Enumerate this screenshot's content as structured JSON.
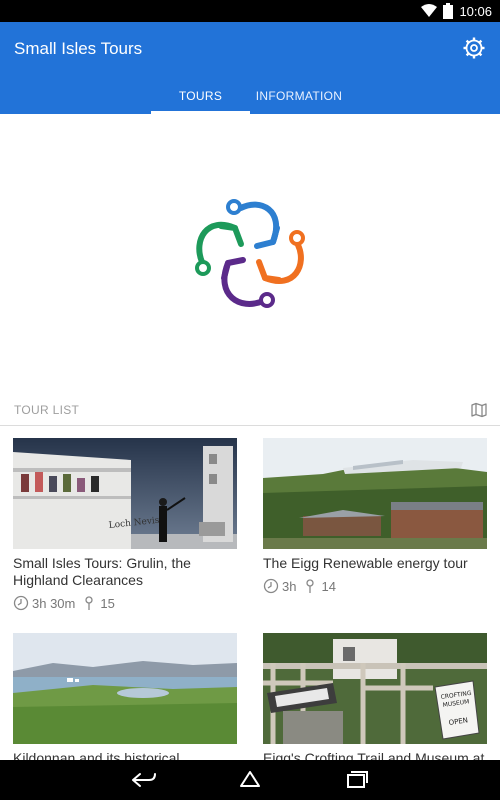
{
  "status": {
    "time": "10:06"
  },
  "app": {
    "title": "Small Isles Tours"
  },
  "tabs": [
    {
      "label": "TOURS"
    },
    {
      "label": "INFORMATION"
    }
  ],
  "section": {
    "title": "TOUR LIST"
  },
  "tours": [
    {
      "title": "Small Isles Tours: Grulin, the Highland Clearances",
      "duration": "3h 30m",
      "stops": "15"
    },
    {
      "title": "The Eigg Renewable energy tour",
      "duration": "3h",
      "stops": "14"
    },
    {
      "title": "Kildonnan and its historical",
      "duration": "",
      "stops": ""
    },
    {
      "title": "Eigg's Crofting Trail and Museum at",
      "duration": "",
      "stops": ""
    }
  ],
  "images": {
    "sign_text": "CROFTING MUSEUM OPEN"
  },
  "colors": {
    "primary": "#2273d8"
  }
}
